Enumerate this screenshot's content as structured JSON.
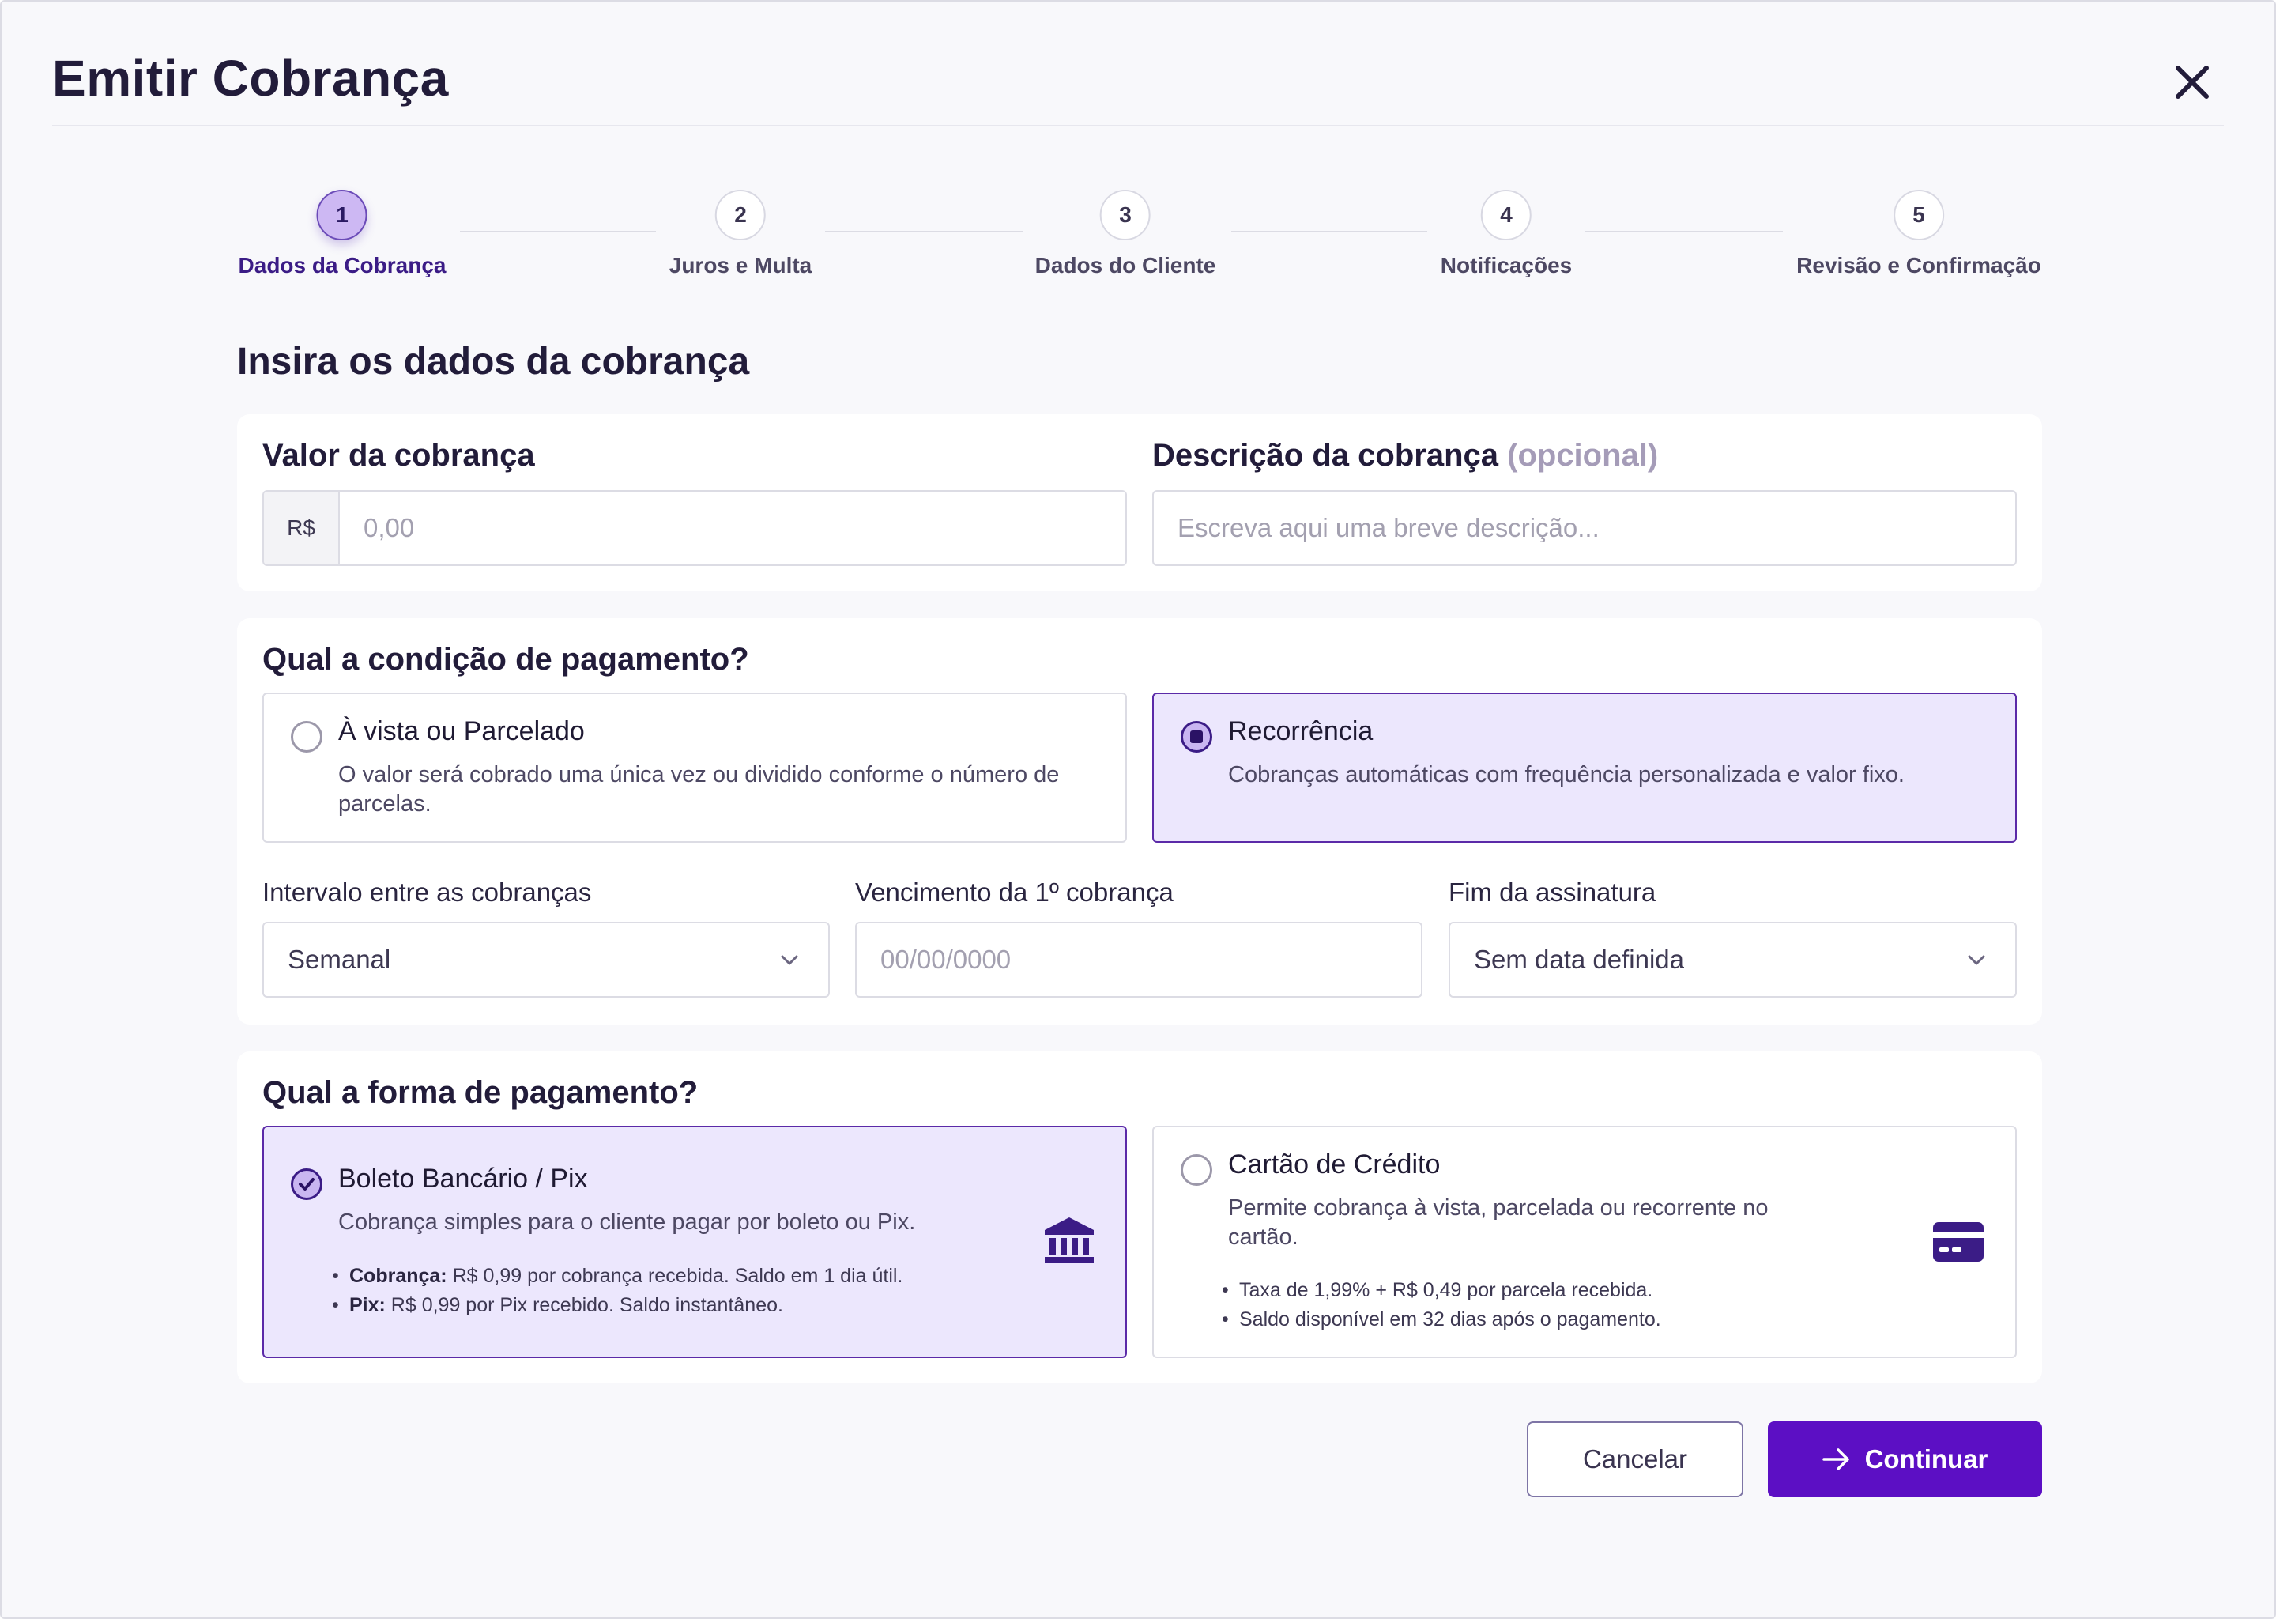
{
  "modal": {
    "title": "Emitir Cobrança",
    "close_icon": "close-icon"
  },
  "stepper": {
    "steps": [
      {
        "number": "1",
        "label": "Dados da Cobrança",
        "active": true
      },
      {
        "number": "2",
        "label": "Juros e Multa",
        "active": false
      },
      {
        "number": "3",
        "label": "Dados do Cliente",
        "active": false
      },
      {
        "number": "4",
        "label": "Notificações",
        "active": false
      },
      {
        "number": "5",
        "label": "Revisão e Confirmação",
        "active": false
      }
    ]
  },
  "section_heading": "Insira os dados da cobrança",
  "charge": {
    "value_label": "Valor da cobrança",
    "currency_prefix": "R$",
    "value_placeholder": "0,00",
    "description_label": "Descrição da cobrança",
    "description_optional": "(opcional)",
    "description_placeholder": "Escreva aqui uma breve descrição..."
  },
  "payment_condition": {
    "heading": "Qual a condição de pagamento?",
    "options": [
      {
        "title": "À vista ou Parcelado",
        "desc": "O valor será cobrado uma única vez ou dividido conforme o número de parcelas.",
        "selected": false
      },
      {
        "title": "Recorrência",
        "desc": "Cobranças automáticas com frequência personalizada e valor fixo.",
        "selected": true
      }
    ],
    "interval_label": "Intervalo entre as cobranças",
    "interval_value": "Semanal",
    "first_due_label": "Vencimento da 1º cobrança",
    "first_due_placeholder": "00/00/0000",
    "end_label": "Fim da assinatura",
    "end_value": "Sem data definida"
  },
  "payment_method": {
    "heading": "Qual a forma de pagamento?",
    "options": [
      {
        "title": "Boleto Bancário / Pix",
        "desc": "Cobrança simples para o cliente pagar por boleto ou Pix.",
        "selected": true,
        "icon": "bank-icon",
        "bullets": [
          {
            "strong": "Cobrança:",
            "text": " R$ 0,99 por cobrança recebida. Saldo em 1 dia útil."
          },
          {
            "strong": "Pix:",
            "text": " R$ 0,99 por Pix recebido. Saldo instantâneo."
          }
        ]
      },
      {
        "title": "Cartão de Crédito",
        "desc": "Permite cobrança à vista, parcelada ou recorrente no cartão.",
        "selected": false,
        "icon": "credit-card-icon",
        "bullets": [
          {
            "text": "Taxa de 1,99% + R$ 0,49 por parcela recebida."
          },
          {
            "text": "Saldo disponível em 32 dias após o pagamento."
          }
        ]
      }
    ]
  },
  "actions": {
    "cancel_label": "Cancelar",
    "continue_label": "Continuar",
    "continue_icon": "arrow-right-icon"
  },
  "colors": {
    "accent": "#5c0fc4",
    "selected_bg": "#ece7fd",
    "selected_border": "#5b2aa8",
    "text_dark": "#221c3a",
    "muted": "#a59cb8"
  }
}
